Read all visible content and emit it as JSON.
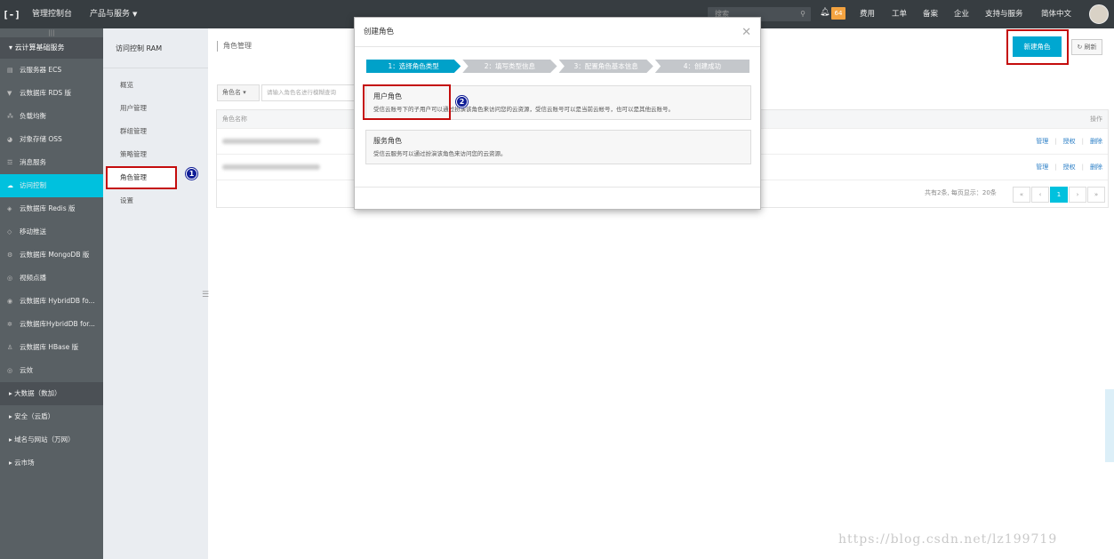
{
  "topbar": {
    "console": "管理控制台",
    "products": "产品与服务",
    "search_placeholder": "搜索",
    "notification_count": "64",
    "links": [
      "费用",
      "工单",
      "备案",
      "企业",
      "支持与服务",
      "简体中文"
    ]
  },
  "sidebar": {
    "group": "云计算基础服务",
    "items": [
      {
        "label": "云服务器 ECS",
        "icon": "server-icon"
      },
      {
        "label": "云数据库 RDS 版",
        "icon": "database-icon"
      },
      {
        "label": "负载均衡",
        "icon": "load-balancer-icon"
      },
      {
        "label": "对象存储 OSS",
        "icon": "storage-icon"
      },
      {
        "label": "消息服务",
        "icon": "message-icon"
      },
      {
        "label": "访问控制",
        "icon": "cloud-key-icon"
      },
      {
        "label": "云数据库 Redis 版",
        "icon": "redis-icon"
      },
      {
        "label": "移动推送",
        "icon": "push-icon"
      },
      {
        "label": "云数据库 MongoDB 版",
        "icon": "mongodb-icon"
      },
      {
        "label": "视频点播",
        "icon": "video-icon"
      },
      {
        "label": "云数据库 HybridDB fo...",
        "icon": "hybriddb-icon"
      },
      {
        "label": "云数据库HybridDB for...",
        "icon": "hybriddb-icon"
      },
      {
        "label": "云数据库 HBase 版",
        "icon": "hbase-icon"
      },
      {
        "label": "云效",
        "icon": "devops-icon"
      }
    ],
    "collapsed": [
      "大数据（数加）",
      "安全（云盾）",
      "域名与网站（万网）",
      "云市场"
    ]
  },
  "subnav": {
    "title": "访问控制 RAM",
    "items": [
      "概览",
      "用户管理",
      "群组管理",
      "策略管理",
      "角色管理",
      "设置"
    ]
  },
  "main": {
    "breadcrumb": "角色管理",
    "new_button": "新建角色",
    "refresh_button": "刷新",
    "filter_select": "角色名",
    "filter_placeholder": "请输入角色名进行模糊查询",
    "table": {
      "col_name": "角色名称",
      "col_ops": "操作",
      "row_actions": [
        "管理",
        "授权",
        "删除"
      ],
      "rows": 2
    },
    "pagination": {
      "info": "共有2条, 每页显示：20条",
      "current": "1"
    }
  },
  "modal": {
    "title": "创建角色",
    "steps": [
      "1：选择角色类型",
      "2：填写类型信息",
      "3：配置角色基本信息",
      "4：创建成功"
    ],
    "options": [
      {
        "title": "用户角色",
        "desc": "受信云账号下的子用户可以通过扮演该角色来访问您的云资源，受信云账号可以是当前云帐号，也可以是其他云账号。"
      },
      {
        "title": "服务角色",
        "desc": "受信云服务可以通过扮演该角色来访问您的云资源。"
      }
    ]
  },
  "markers": [
    "1",
    "2"
  ],
  "watermark": "https://blog.csdn.net/lz199719",
  "colors": {
    "accent": "#00c1de",
    "primary_button": "#00a7d1",
    "highlight_box": "#c40c0c",
    "topbar": "#373d41"
  }
}
